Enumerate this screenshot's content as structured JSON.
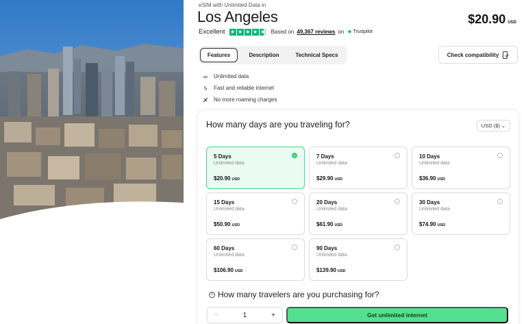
{
  "header": {
    "eyebrow": "eSIM with Unlimited Data in",
    "city": "Los Angeles",
    "price": "$20.90",
    "price_currency": "USD"
  },
  "rating": {
    "label": "Excellent",
    "stars": 4.5,
    "based_on": "Based on",
    "reviews": "49,367 reviews",
    "on": "on",
    "provider": "Trustpilot"
  },
  "tabs": [
    {
      "label": "Features",
      "active": true
    },
    {
      "label": "Description",
      "active": false
    },
    {
      "label": "Technical Specs",
      "active": false
    }
  ],
  "compat_label": "Check compatibility",
  "features": [
    {
      "icon": "infinity-icon",
      "label": "Unlimited data"
    },
    {
      "icon": "lightning-icon",
      "label": "Fast and reliable internet"
    },
    {
      "icon": "no-roaming-icon",
      "label": "No more roaming charges"
    }
  ],
  "plans_panel": {
    "question": "How many days are you traveling for?",
    "currency_selector": "USD ($)",
    "plans": [
      {
        "days": "5 Days",
        "data": "Unlimited data",
        "price": "$20.90",
        "currency": "USD",
        "selected": true
      },
      {
        "days": "7 Days",
        "data": "Unlimited data",
        "price": "$29.90",
        "currency": "USD",
        "selected": false
      },
      {
        "days": "10 Days",
        "data": "Unlimited data",
        "price": "$36.90",
        "currency": "USD",
        "selected": false
      },
      {
        "days": "15 Days",
        "data": "Unlimited data",
        "price": "$50.90",
        "currency": "USD",
        "selected": false
      },
      {
        "days": "20 Days",
        "data": "Unlimited data",
        "price": "$61.90",
        "currency": "USD",
        "selected": false
      },
      {
        "days": "30 Days",
        "data": "Unlimited data",
        "price": "$74.90",
        "currency": "USD",
        "selected": false
      },
      {
        "days": "60 Days",
        "data": "Unlimited data",
        "price": "$106.90",
        "currency": "USD",
        "selected": false
      },
      {
        "days": "90 Days",
        "data": "Unlimited data",
        "price": "$139.90",
        "currency": "USD",
        "selected": false
      }
    ],
    "travelers_question": "How many travelers are you purchasing for?",
    "quantity": "1",
    "minus": "−",
    "plus": "+",
    "cta": "Get unlimited internet"
  },
  "colors": {
    "accent": "#55e08f",
    "selected_border": "#3ddc84",
    "selected_bg": "#eafbf1",
    "trustpilot": "#00b67a"
  }
}
